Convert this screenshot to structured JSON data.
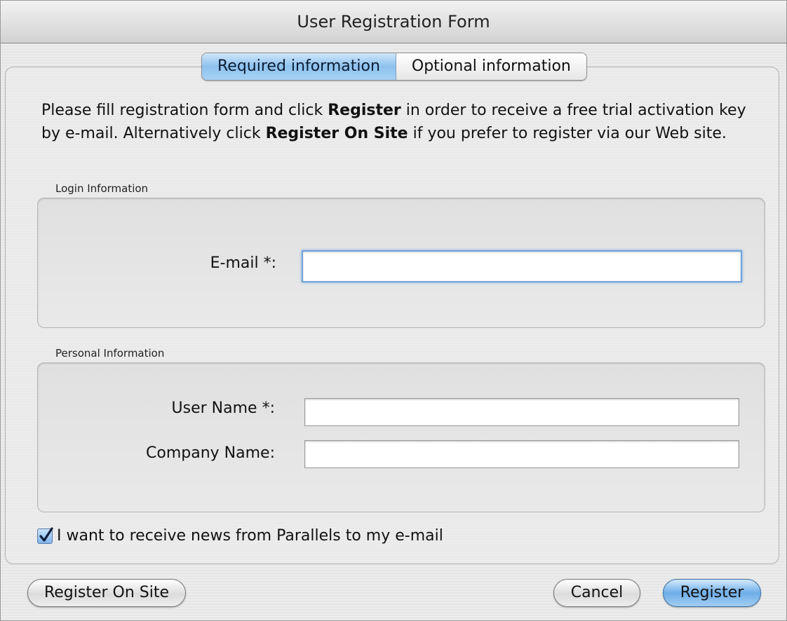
{
  "window": {
    "title": "User Registration Form"
  },
  "tabs": [
    {
      "label": "Required information",
      "active": true
    },
    {
      "label": "Optional information",
      "active": false
    }
  ],
  "intro": {
    "part1": "Please fill registration form and click ",
    "bold1": "Register",
    "part2": " in order to receive a free trial activation key by e-mail. Alternatively click ",
    "bold2": "Register On Site",
    "part3": " if you prefer to register via our Web site."
  },
  "login_section": {
    "title": "Login Information",
    "email_label": "E-mail *:",
    "email_value": ""
  },
  "personal_section": {
    "title": "Personal Information",
    "username_label": "User Name *:",
    "username_value": "",
    "company_label": "Company Name:",
    "company_value": ""
  },
  "newsletter": {
    "label": "I want to receive news from Parallels to my e-mail",
    "checked": true
  },
  "buttons": {
    "register_on_site": "Register On Site",
    "cancel": "Cancel",
    "register": "Register"
  },
  "colors": {
    "accent_blue": "#8ec2ee",
    "focus_ring": "#6fa2d8"
  }
}
